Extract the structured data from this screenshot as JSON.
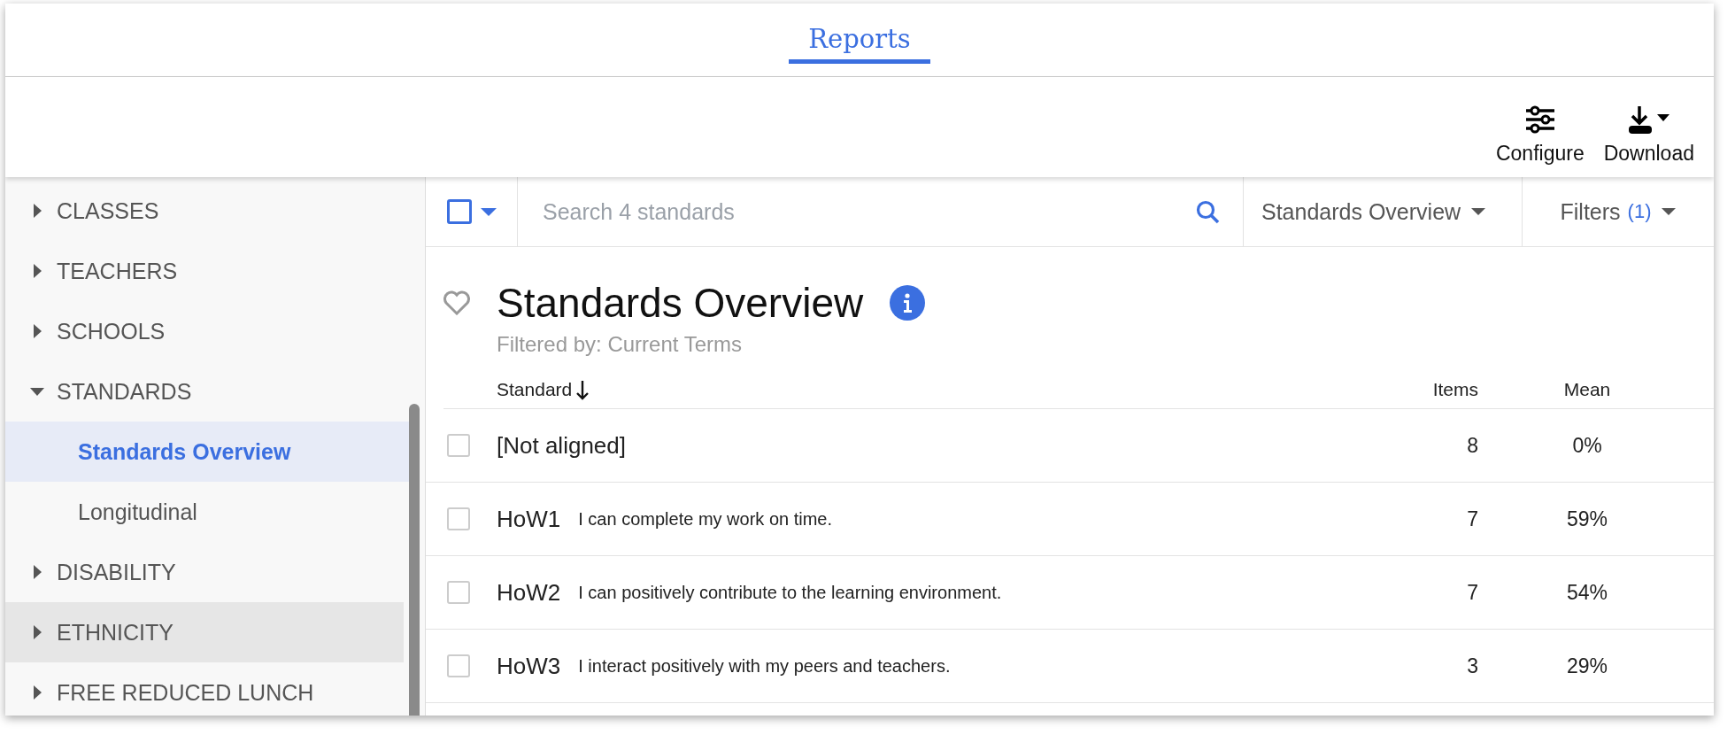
{
  "tabs": [
    {
      "label": "Reports",
      "selected": true
    }
  ],
  "actions": [
    {
      "kind": "configure",
      "label": "Configure"
    },
    {
      "kind": "download",
      "label": "Download"
    }
  ],
  "sidebar": {
    "items": [
      {
        "label": "CLASSES",
        "expanded": false,
        "hovered": false
      },
      {
        "label": "TEACHERS",
        "expanded": false,
        "hovered": false
      },
      {
        "label": "SCHOOLS",
        "expanded": false,
        "hovered": false
      },
      {
        "label": "STANDARDS",
        "expanded": true,
        "hovered": false,
        "children": [
          {
            "label": "Standards Overview",
            "selected": true
          },
          {
            "label": "Longitudinal",
            "selected": false
          }
        ]
      },
      {
        "label": "DISABILITY",
        "expanded": false,
        "hovered": false
      },
      {
        "label": "ETHNICITY",
        "expanded": false,
        "hovered": true
      },
      {
        "label": "FREE REDUCED LUNCH",
        "expanded": false,
        "hovered": false
      }
    ]
  },
  "filter_bar": {
    "select_all_checked": false,
    "search": {
      "placeholder": "Search 4 standards"
    },
    "view": "Standards Overview",
    "filters": {
      "label": "Filters",
      "count": "(1)"
    }
  },
  "report": {
    "favorite": false,
    "title": "Standards Overview",
    "subtitle": "Filtered by: Current Terms"
  },
  "table": {
    "columns": [
      {
        "label": "Standard",
        "sorted": true
      },
      {
        "label": "Items",
        "sorted": false
      },
      {
        "label": "Mean",
        "sorted": false
      }
    ],
    "rows": [
      {
        "checked": false,
        "code": "[Not aligned]",
        "items": "8",
        "mean": "0%"
      },
      {
        "checked": false,
        "code": "HoW1",
        "description": "I can complete my work on time.",
        "items": "7",
        "mean": "59%"
      },
      {
        "checked": false,
        "code": "HoW2",
        "description": "I can positively contribute to the learning environment.",
        "items": "7",
        "mean": "54%"
      },
      {
        "checked": false,
        "code": "HoW3",
        "description": "I interact positively with my peers and teachers.",
        "items": "3",
        "mean": "29%"
      }
    ]
  }
}
